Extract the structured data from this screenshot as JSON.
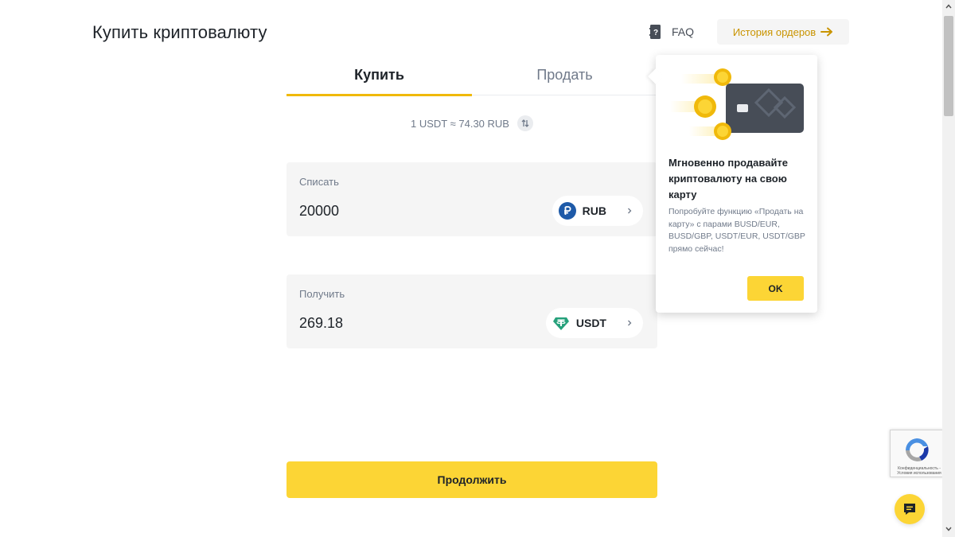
{
  "header": {
    "title": "Купить криптовалюту",
    "faq_label": "FAQ",
    "orders_label": "История ордеров"
  },
  "tabs": [
    {
      "label": "Купить",
      "active": true
    },
    {
      "label": "Продать",
      "active": false
    }
  ],
  "rate": {
    "text": "1 USDT ≈ 74.30 RUB"
  },
  "pay": {
    "label": "Списать",
    "value": "20000",
    "currency": "RUB",
    "currency_icon": "ruble-icon"
  },
  "receive": {
    "label": "Получить",
    "value": "269.18",
    "currency": "USDT",
    "currency_icon": "tether-icon"
  },
  "continue_label": "Продолжить",
  "popover": {
    "title": "Мгновенно продавайте криптовалюту на свою карту",
    "description": "Попробуйте функцию «Продать на карту» с парами BUSD/EUR, BUSD/GBP, USDT/EUR, USDT/GBP прямо сейчас!",
    "ok_label": "OK"
  },
  "recaptcha": {
    "text": "Конфиденциальность - Условия использования"
  },
  "colors": {
    "accent": "#fcd535",
    "tab_underline": "#f0b90b",
    "link": "#c99400",
    "ruble": "#1e5aa8",
    "tether": "#26a17b"
  }
}
